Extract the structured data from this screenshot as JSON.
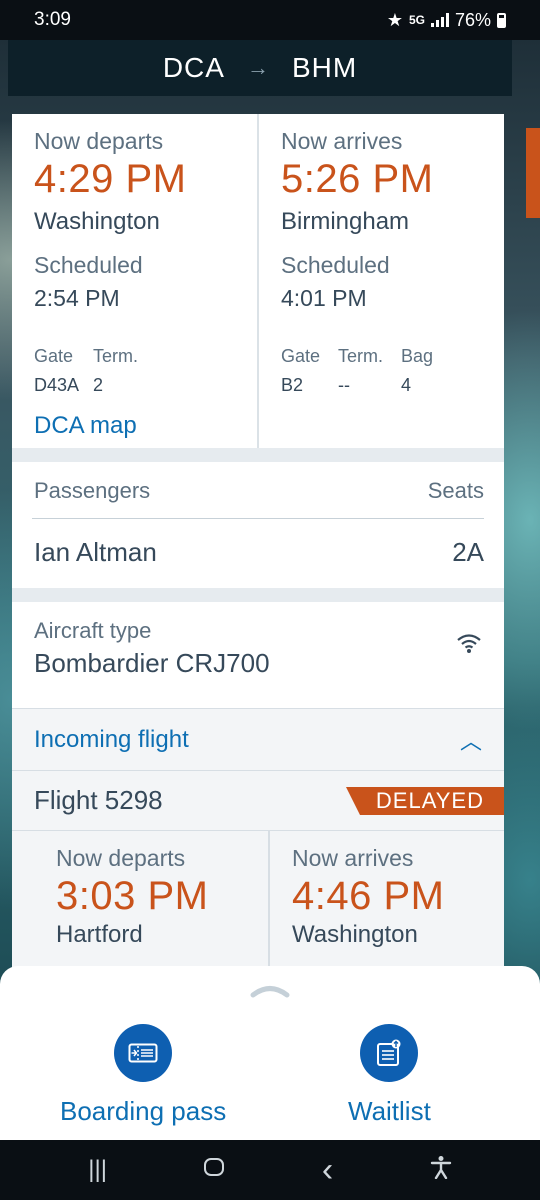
{
  "status_bar": {
    "time": "3:09",
    "network": "5G",
    "battery": "76%"
  },
  "route": {
    "origin": "DCA",
    "destination": "BHM",
    "arrow": "→"
  },
  "departure": {
    "label": "Now departs",
    "time": "4:29 PM",
    "city": "Washington",
    "scheduled_label": "Scheduled",
    "scheduled_time": "2:54 PM",
    "gate_label": "Gate",
    "gate": "D43A",
    "term_label": "Term.",
    "term": "2",
    "map_link": "DCA map"
  },
  "arrival": {
    "label": "Now arrives",
    "time": "5:26 PM",
    "city": "Birmingham",
    "scheduled_label": "Scheduled",
    "scheduled_time": "4:01 PM",
    "gate_label": "Gate",
    "gate": "B2",
    "term_label": "Term.",
    "term": "--",
    "bag_label": "Bag",
    "bag": "4"
  },
  "passengers": {
    "header": "Passengers",
    "seats_header": "Seats",
    "name": "Ian Altman",
    "seat": "2A"
  },
  "aircraft": {
    "label": "Aircraft type",
    "value": "Bombardier CRJ700",
    "icon": "wifi-icon"
  },
  "incoming": {
    "title": "Incoming flight",
    "flight": "Flight 5298",
    "status": "DELAYED",
    "departs_label": "Now departs",
    "departs_time": "3:03 PM",
    "departs_city": "Hartford",
    "arrives_label": "Now arrives",
    "arrives_time": "4:46 PM",
    "arrives_city": "Washington"
  },
  "bottom_sheet": {
    "boarding_pass": "Boarding pass",
    "waitlist": "Waitlist"
  },
  "navbar": {
    "recents": "|||",
    "back": "‹"
  },
  "colors": {
    "accent": "#c9531b",
    "link": "#0e6fb3",
    "button": "#0e5fb1"
  }
}
